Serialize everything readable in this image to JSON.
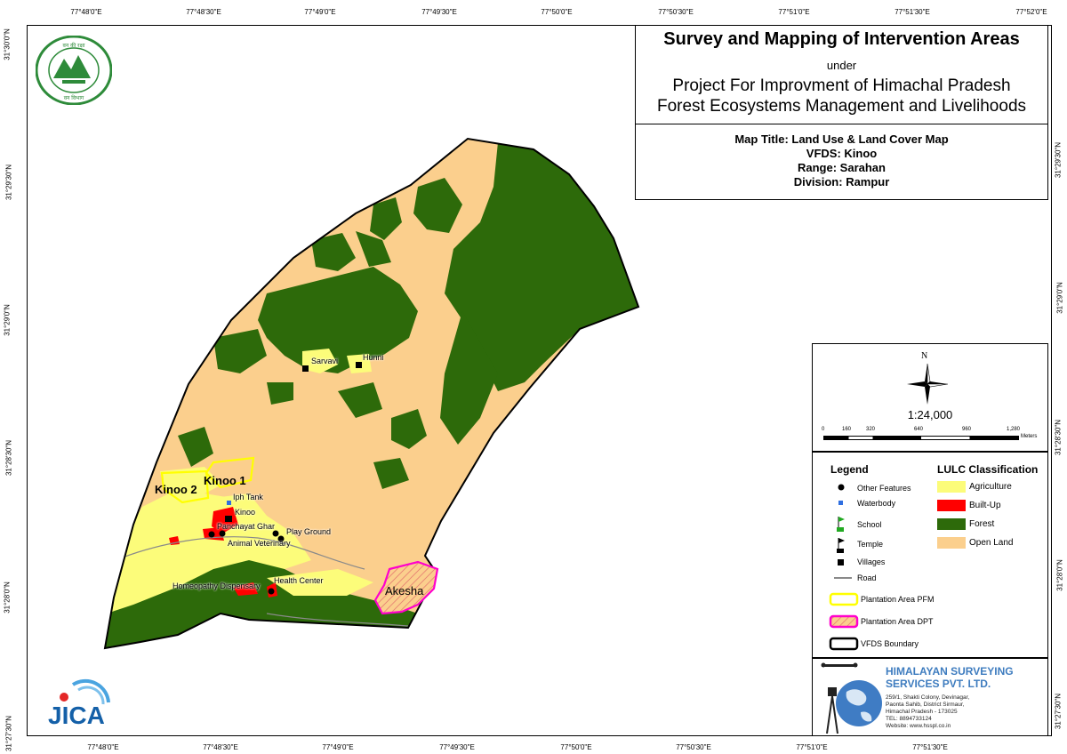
{
  "title": {
    "main": "Survey and Mapping of Intervention Areas",
    "under": "under",
    "project_line1": "Project For Improvment of Himachal Pradesh",
    "project_line2": "Forest Ecosystems Management and Livelihoods",
    "map_title": "Map Title: Land Use & Land Cover Map",
    "vfds": "VFDS: Kinoo",
    "range": "Range: Sarahan",
    "division": "Division: Rampur"
  },
  "grid": {
    "top_ticks": [
      "77°48'0\"E",
      "77°48'30\"E",
      "77°49'0\"E",
      "77°49'30\"E",
      "77°50'0\"E",
      "77°50'30\"E",
      "77°51'0\"E",
      "77°51'30\"E",
      "77°52'0\"E"
    ],
    "bottom_ticks": [
      "77°48'0\"E",
      "77°48'30\"E",
      "77°49'0\"E",
      "77°49'30\"E",
      "77°50'0\"E",
      "77°50'30\"E",
      "77°51'0\"E",
      "77°51'30\"E"
    ],
    "left_ticks": [
      "31°30'0\"N",
      "31°29'30\"N",
      "31°29'0\"N",
      "31°28'30\"N",
      "31°28'0\"N",
      "31°27'30\"N"
    ],
    "right_ticks": [
      "31°29'30\"N",
      "31°29'0\"N",
      "31°28'30\"N",
      "31°28'0\"N",
      "31°27'30\"N"
    ]
  },
  "places": {
    "sarvavi": "Sarvavi",
    "hunni": "Hunni",
    "kinoo1": "Kinoo 1",
    "kinoo2": "Kinoo 2",
    "iph_tank": "Iph Tank",
    "kinoo": "Kinoo",
    "panchayat": "Panchayat Ghar",
    "play_ground": "Play Ground",
    "animal_vet": "Animal Veterinary",
    "homeopathy": "Homeopathy Dispensary",
    "health": "Health Center",
    "akesha": "Akesha"
  },
  "scale": {
    "north": "N",
    "ratio": "1:24,000",
    "bar_labels": [
      "0",
      "160",
      "320",
      "640",
      "960",
      "1,280"
    ],
    "unit": "Meters"
  },
  "legend": {
    "title": "Legend",
    "lulc_title": "LULC Classification",
    "items": [
      "Other Features",
      "Waterbody",
      "School",
      "Temple",
      "Villages",
      "Road"
    ],
    "lulc": [
      {
        "label": "Agriculture",
        "color": "#fcfc7a"
      },
      {
        "label": "Built-Up",
        "color": "#ff0000"
      },
      {
        "label": "Forest",
        "color": "#2d6a0a"
      },
      {
        "label": "Open Land",
        "color": "#fbcf8d"
      }
    ],
    "areas": [
      "Plantation Area PFM",
      "Plantation Area DPT",
      "VFDS Boundary"
    ]
  },
  "company": {
    "name_line1": "HIMALAYAN SURVEYING",
    "name_line2": "SERVICES PVT. LTD.",
    "address": [
      "259/1, Shakti Colony, Devinagar,",
      "Paonta Sahib, District Sirmaur,",
      "Himachal Pradesh - 173025",
      "TEL: 8894733124",
      "Website: www.hsspl.co.in"
    ]
  },
  "logos": {
    "jica": "JICA",
    "hp_forest": "वन की रक्षा, विकास कल्याण · वन विभाग हिमाचल प्रदेश"
  },
  "colors": {
    "open_land": "#fbcf8d",
    "forest": "#2d6a0a",
    "agriculture": "#fcfc7a",
    "built_up": "#ff0000",
    "pfm": "#ffff00",
    "dpt": "#ff00cc"
  }
}
